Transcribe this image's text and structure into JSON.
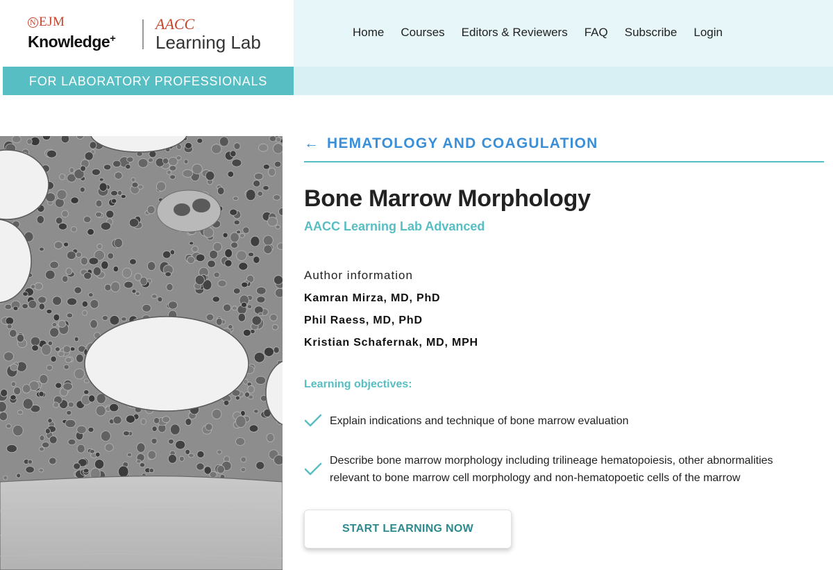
{
  "brand": {
    "nejm_mark": "N",
    "nejm_letters": "EJM",
    "knowledge": "Knowledge",
    "plus": "+",
    "aacc": "AACC",
    "learning_lab": "Learning Lab",
    "tagline": "FOR LABORATORY PROFESSIONALS",
    "accent_color": "#57bec3",
    "logo_red": "#c8452c"
  },
  "nav": {
    "items": [
      {
        "label": "Home"
      },
      {
        "label": "Courses"
      },
      {
        "label": "Editors & Reviewers"
      },
      {
        "label": "FAQ"
      },
      {
        "label": "Subscribe"
      },
      {
        "label": "Login"
      }
    ]
  },
  "course": {
    "back_icon": "arrow-left-icon",
    "back_arrow": "←",
    "category": "HEMATOLOGY AND COAGULATION",
    "title": "Bone Marrow Morphology",
    "subtitle": "AACC Learning Lab Advanced",
    "author_heading": "Author information",
    "authors": [
      "Kamran Mirza, MD, PhD",
      "Phil Raess, MD, PhD",
      "Kristian Schafernak, MD, MPH"
    ],
    "objectives_heading": "Learning objectives:",
    "objectives": [
      "Explain indications and technique of bone marrow evaluation",
      "Describe bone marrow morphology including trilineage hematopoiesis, other abnormalities relevant to bone marrow cell morphology and non-hematopoetic cells of the marrow"
    ],
    "objective_icon": "checkmark-icon",
    "cta_label": "START LEARNING NOW",
    "link_color": "#3a8fd9"
  }
}
